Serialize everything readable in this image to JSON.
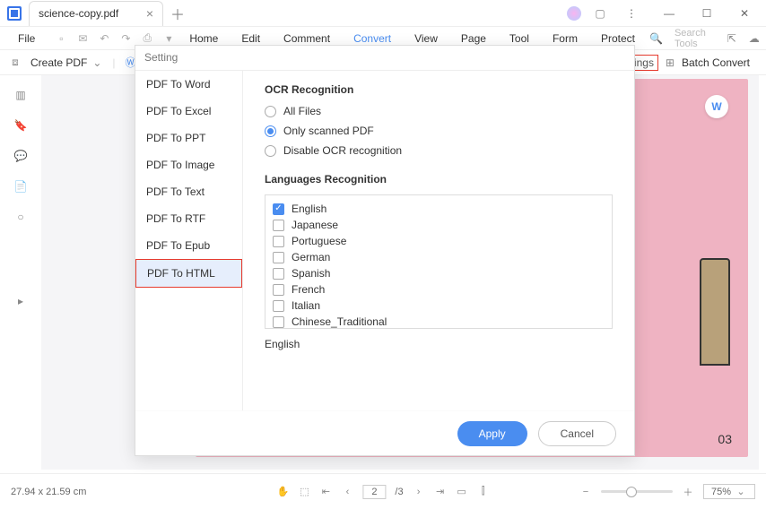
{
  "titlebar": {
    "tab_name": "science-copy.pdf"
  },
  "menubar": {
    "file": "File",
    "items": [
      "Home",
      "Edit",
      "Comment",
      "Convert",
      "View",
      "Page",
      "Tool",
      "Form",
      "Protect"
    ],
    "active_index": 3,
    "search_placeholder": "Search Tools"
  },
  "secondbar": {
    "create_pdf": "Create PDF",
    "to_w": "To W",
    "settings_hl": "tings",
    "batch_convert": "Batch Convert"
  },
  "dialog": {
    "title": "Setting",
    "side_items": [
      "PDF To Word",
      "PDF To Excel",
      "PDF To PPT",
      "PDF To Image",
      "PDF To Text",
      "PDF To RTF",
      "PDF To Epub",
      "PDF To HTML"
    ],
    "highlight_index": 7,
    "ocr_heading": "OCR Recognition",
    "ocr_options": [
      "All Files",
      "Only scanned PDF",
      "Disable OCR recognition"
    ],
    "ocr_selected": 1,
    "lang_heading": "Languages Recognition",
    "languages": [
      {
        "name": "English",
        "checked": true
      },
      {
        "name": "Japanese",
        "checked": false
      },
      {
        "name": "Portuguese",
        "checked": false
      },
      {
        "name": "German",
        "checked": false
      },
      {
        "name": "Spanish",
        "checked": false
      },
      {
        "name": "French",
        "checked": false
      },
      {
        "name": "Italian",
        "checked": false
      },
      {
        "name": "Chinese_Traditional",
        "checked": false
      }
    ],
    "selected_lang_summary": "English",
    "apply": "Apply",
    "cancel": "Cancel"
  },
  "page": {
    "doc_num": "03",
    "word_badge": "W"
  },
  "statusbar": {
    "dimensions": "27.94 x 21.59 cm",
    "page_current": "2",
    "page_total": "/3",
    "zoom": "75%"
  }
}
